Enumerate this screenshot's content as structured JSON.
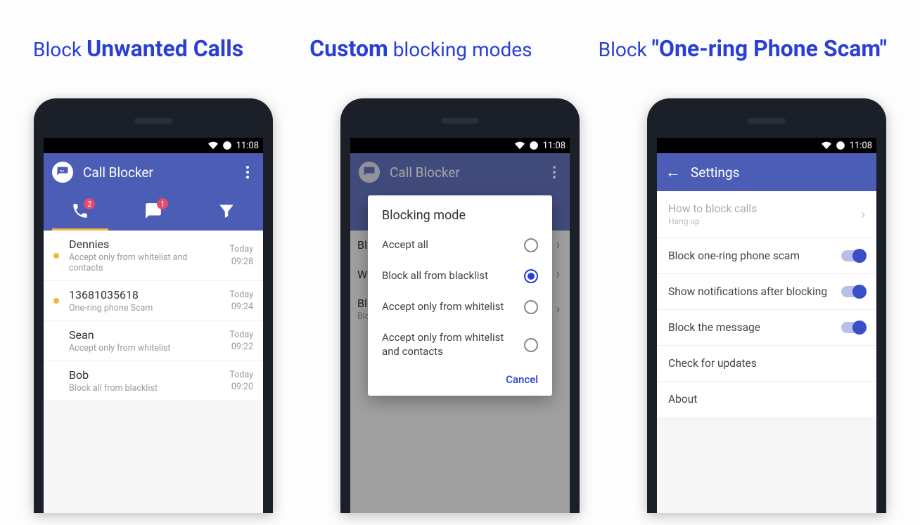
{
  "captions": [
    {
      "thin": "Block",
      "bold": "Unwanted Calls"
    },
    {
      "bold": "Custom",
      "thin": "blocking modes"
    },
    {
      "thin": "Block",
      "bold": "\"One-ring Phone Scam\""
    }
  ],
  "statusbar": {
    "time": "11:08"
  },
  "phone1": {
    "app_title": "Call Blocker",
    "tabs": {
      "calls_badge": "2",
      "msgs_badge": "1"
    },
    "rows": [
      {
        "dot": true,
        "title": "Dennies",
        "sub": "Accept only from whitelist and contacts",
        "day": "Today",
        "time": "09:28"
      },
      {
        "dot": true,
        "title": "13681035618",
        "sub": "One-ring phone Scam",
        "day": "Today",
        "time": "09:24"
      },
      {
        "dot": false,
        "title": "Sean",
        "sub": "Accept only from whitelist",
        "day": "Today",
        "time": "09:22"
      },
      {
        "dot": false,
        "title": "Bob",
        "sub": "Block all from blacklist",
        "day": "Today",
        "time": "09:20"
      }
    ]
  },
  "phone2": {
    "app_title": "Call Blocker",
    "bg_rows": [
      {
        "title": "Bl",
        "sub": ""
      },
      {
        "title": "Wl",
        "sub": ""
      },
      {
        "title": "Bl",
        "sub": "Blo"
      }
    ],
    "dialog": {
      "title": "Blocking mode",
      "options": [
        {
          "label": "Accept all",
          "selected": false
        },
        {
          "label": "Block all from blacklist",
          "selected": true
        },
        {
          "label": "Accept only from whitelist",
          "selected": false
        },
        {
          "label": "Accept only from whitelist and contacts",
          "selected": false
        }
      ],
      "cancel": "Cancel"
    }
  },
  "phone3": {
    "app_title": "Settings",
    "rows": [
      {
        "title": "How to block calls",
        "sub": "Hang up",
        "type": "chev",
        "muted": true
      },
      {
        "title": "Block one-ring phone scam",
        "type": "switch"
      },
      {
        "title": "Show notifications after blocking",
        "type": "switch"
      },
      {
        "title": "Block the message",
        "type": "switch"
      },
      {
        "title": "Check for updates",
        "type": "none"
      },
      {
        "title": "About",
        "type": "none"
      }
    ]
  }
}
